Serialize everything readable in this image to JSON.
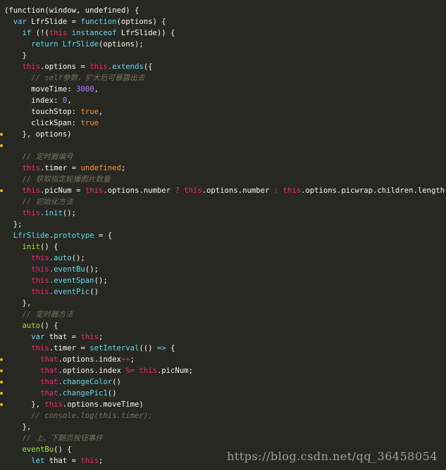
{
  "editor": {
    "watermark": "https://blog.csdn.net/qq_36458054",
    "lines": [
      {
        "tokens": [
          [
            "t-plain",
            "(function(window, undefined) {"
          ]
        ]
      },
      {
        "tokens": [
          [
            "t-kw",
            "  var "
          ],
          [
            "t-plain",
            "LfrSlide = "
          ],
          [
            "t-kw",
            "function"
          ],
          [
            "t-plain",
            "(options) {"
          ]
        ]
      },
      {
        "tokens": [
          [
            "t-kw",
            "    if "
          ],
          [
            "t-plain",
            "(!("
          ],
          [
            "t-this",
            "this"
          ],
          [
            "t-kw",
            " instanceof "
          ],
          [
            "t-plain",
            "LfrSlide)) {"
          ]
        ]
      },
      {
        "tokens": [
          [
            "t-kw",
            "      return "
          ],
          [
            "t-fn",
            "LfrSlide"
          ],
          [
            "t-plain",
            "(options);"
          ]
        ]
      },
      {
        "tokens": [
          [
            "t-plain",
            "    }"
          ]
        ]
      },
      {
        "tokens": [
          [
            "t-this",
            "    this"
          ],
          [
            "t-prop",
            ".options"
          ],
          [
            "t-plain",
            " = "
          ],
          [
            "t-this",
            "this"
          ],
          [
            "t-fn",
            ".extends"
          ],
          [
            "t-plain",
            "({"
          ]
        ]
      },
      {
        "tokens": [
          [
            "t-cmt",
            "      // self参数，扩大后可暴露出去"
          ]
        ]
      },
      {
        "tokens": [
          [
            "t-plain",
            "      moveTime: "
          ],
          [
            "t-num",
            "3000"
          ],
          [
            "t-plain",
            ","
          ]
        ]
      },
      {
        "tokens": [
          [
            "t-plain",
            "      index: "
          ],
          [
            "t-num",
            "0"
          ],
          [
            "t-plain",
            ","
          ]
        ]
      },
      {
        "tokens": [
          [
            "t-plain",
            "      touchStop: "
          ],
          [
            "t-bool",
            "true"
          ],
          [
            "t-plain",
            ","
          ]
        ]
      },
      {
        "tokens": [
          [
            "t-plain",
            "      clickSpan: "
          ],
          [
            "t-bool",
            "true"
          ]
        ]
      },
      {
        "tokens": [
          [
            "t-plain",
            "    }, options)"
          ]
        ]
      },
      {
        "tokens": [
          [
            "t-plain",
            ""
          ]
        ]
      },
      {
        "tokens": [
          [
            "t-cmt",
            "    // 定时器编号"
          ]
        ]
      },
      {
        "tokens": [
          [
            "t-this",
            "    this"
          ],
          [
            "t-prop",
            ".timer"
          ],
          [
            "t-plain",
            " = "
          ],
          [
            "t-bool",
            "undefined"
          ],
          [
            "t-plain",
            ";"
          ]
        ]
      },
      {
        "tokens": [
          [
            "t-cmt",
            "    // 获取指定轮播图片数量"
          ]
        ]
      },
      {
        "tokens": [
          [
            "t-this",
            "    this"
          ],
          [
            "t-prop",
            ".picNum"
          ],
          [
            "t-plain",
            " = "
          ],
          [
            "t-this",
            "this"
          ],
          [
            "t-prop",
            ".options.number"
          ],
          [
            "t-op",
            " ? "
          ],
          [
            "t-this",
            "this"
          ],
          [
            "t-prop",
            ".options.number"
          ],
          [
            "t-op",
            " : "
          ],
          [
            "t-this",
            "this"
          ],
          [
            "t-prop",
            ".options.picwrap.children.length"
          ],
          [
            "t-plain",
            ";"
          ]
        ]
      },
      {
        "tokens": [
          [
            "t-cmt",
            "    // 初始化方法"
          ]
        ]
      },
      {
        "tokens": [
          [
            "t-this",
            "    this"
          ],
          [
            "t-fn",
            ".init"
          ],
          [
            "t-plain",
            "();"
          ]
        ]
      },
      {
        "tokens": [
          [
            "t-plain",
            "  };"
          ]
        ]
      },
      {
        "tokens": [
          [
            "t-fn",
            "  LfrSlide"
          ],
          [
            "t-plain",
            "."
          ],
          [
            "t-fn",
            "prototype"
          ],
          [
            "t-plain",
            " = {"
          ]
        ]
      },
      {
        "tokens": [
          [
            "t-meth",
            "    init"
          ],
          [
            "t-plain",
            "() {"
          ]
        ]
      },
      {
        "tokens": [
          [
            "t-this",
            "      this"
          ],
          [
            "t-fn",
            ".auto"
          ],
          [
            "t-plain",
            "();"
          ]
        ]
      },
      {
        "tokens": [
          [
            "t-this",
            "      this"
          ],
          [
            "t-fn",
            ".eventBu"
          ],
          [
            "t-plain",
            "();"
          ]
        ]
      },
      {
        "tokens": [
          [
            "t-this",
            "      this"
          ],
          [
            "t-fn",
            ".eventSpan"
          ],
          [
            "t-plain",
            "();"
          ]
        ]
      },
      {
        "tokens": [
          [
            "t-this",
            "      this"
          ],
          [
            "t-fn",
            ".eventPic"
          ],
          [
            "t-plain",
            "()"
          ]
        ]
      },
      {
        "tokens": [
          [
            "t-plain",
            "    },"
          ]
        ]
      },
      {
        "tokens": [
          [
            "t-cmt",
            "    // 定时器方法"
          ]
        ]
      },
      {
        "tokens": [
          [
            "t-meth",
            "    auto"
          ],
          [
            "t-plain",
            "() {"
          ]
        ]
      },
      {
        "tokens": [
          [
            "t-kw",
            "      var "
          ],
          [
            "t-plain",
            "that = "
          ],
          [
            "t-this",
            "this"
          ],
          [
            "t-plain",
            ";"
          ]
        ]
      },
      {
        "tokens": [
          [
            "t-this",
            "      this"
          ],
          [
            "t-prop",
            ".timer"
          ],
          [
            "t-plain",
            " = "
          ],
          [
            "t-fn",
            "setInterval"
          ],
          [
            "t-plain",
            "(() "
          ],
          [
            "t-arrow",
            "=>"
          ],
          [
            "t-plain",
            " {"
          ]
        ]
      },
      {
        "tokens": [
          [
            "t-hl",
            "        that"
          ],
          [
            "t-prop",
            ".options.index"
          ],
          [
            "t-op",
            "++"
          ],
          [
            "t-plain",
            ";"
          ]
        ]
      },
      {
        "tokens": [
          [
            "t-hl",
            "        that"
          ],
          [
            "t-prop",
            ".options.index"
          ],
          [
            "t-op",
            " %= "
          ],
          [
            "t-this",
            "this"
          ],
          [
            "t-prop",
            ".picNum"
          ],
          [
            "t-plain",
            ";"
          ]
        ]
      },
      {
        "tokens": [
          [
            "t-hl",
            "        that"
          ],
          [
            "t-fn",
            ".changeColor"
          ],
          [
            "t-plain",
            "()"
          ]
        ]
      },
      {
        "tokens": [
          [
            "t-hl",
            "        that"
          ],
          [
            "t-fn",
            ".changePic1"
          ],
          [
            "t-plain",
            "()"
          ]
        ]
      },
      {
        "tokens": [
          [
            "t-plain",
            "      }, "
          ],
          [
            "t-this",
            "this"
          ],
          [
            "t-prop",
            ".options.moveTime"
          ],
          [
            "t-plain",
            ")"
          ]
        ]
      },
      {
        "tokens": [
          [
            "t-cmt",
            "      // console.log(this.timer);"
          ]
        ]
      },
      {
        "tokens": [
          [
            "t-plain",
            "    },"
          ]
        ]
      },
      {
        "tokens": [
          [
            "t-cmt",
            "    // 上、下翻页按钮事件"
          ]
        ]
      },
      {
        "tokens": [
          [
            "t-meth",
            "    eventBu"
          ],
          [
            "t-plain",
            "() {"
          ]
        ]
      },
      {
        "tokens": [
          [
            "t-kw",
            "      let "
          ],
          [
            "t-plain",
            "that = "
          ],
          [
            "t-this",
            "this"
          ],
          [
            "t-plain",
            ";"
          ]
        ]
      }
    ]
  }
}
